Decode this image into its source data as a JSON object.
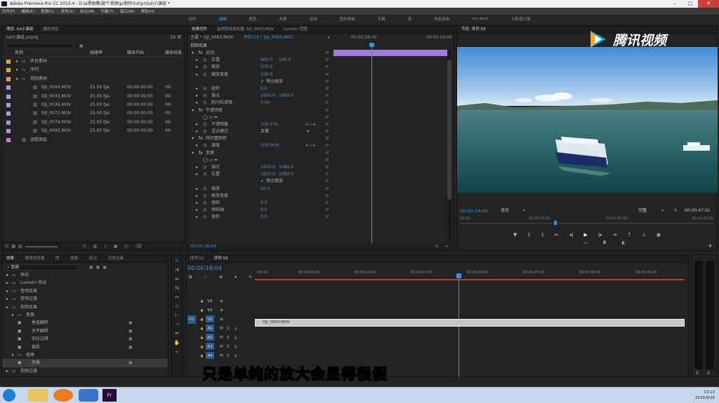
{
  "app": {
    "title": "Adobe Premiere Pro CC 2015.4 - D:\\a黑刚教\\配个视频\\pr制作\\lut\\pr\\lut\\小演组 *"
  },
  "menu": [
    "文件(F)",
    "编辑(E)",
    "剪辑(C)",
    "序列(S)",
    "标记(M)",
    "字幕(T)",
    "窗口(W)",
    "帮助(H)"
  ],
  "workspaces": [
    {
      "label": "组件",
      "active": false
    },
    {
      "label": "编辑",
      "active": true
    },
    {
      "label": "颜色",
      "active": false
    },
    {
      "label": "效果",
      "active": false
    },
    {
      "label": "音频",
      "active": false
    },
    {
      "label": "图形模板",
      "active": false
    },
    {
      "label": "字幕",
      "active": false
    },
    {
      "label": "库",
      "active": false
    },
    {
      "label": "所有面板",
      "active": false
    },
    {
      "label": "my work",
      "active": false
    },
    {
      "label": "元数据记录",
      "active": false
    }
  ],
  "project": {
    "tab": "项目: lut小演组",
    "sub_tab": "媒体浏览",
    "file": "lut小演组.prproj",
    "count": "10 项",
    "col_name": "名称",
    "col_rate": "帧速率",
    "col_start": "媒体开始",
    "col_end": "媒体结束",
    "items": [
      {
        "name": "声音素材",
        "rate": "",
        "start": "",
        "end": "",
        "color": "#e8a23a",
        "type": "folder",
        "indent": 0
      },
      {
        "name": "序列",
        "rate": "",
        "start": "",
        "end": "",
        "color": "#e8a23a",
        "type": "folder",
        "indent": 0
      },
      {
        "name": "视频素材",
        "rate": "",
        "start": "",
        "end": "",
        "color": "#e8a23a",
        "type": "folder",
        "indent": 0
      },
      {
        "name": "DJI_0004.MOV",
        "rate": "25.00 fps",
        "start": "00:00:00:00",
        "end": "00:",
        "color": "#a99bd8",
        "type": "clip",
        "indent": 1
      },
      {
        "name": "DJI_0033.MOV",
        "rate": "25.00 fps",
        "start": "00:00:00:00",
        "end": "00:",
        "color": "#a99bd8",
        "type": "clip",
        "indent": 1
      },
      {
        "name": "DJI_0036.MOV",
        "rate": "25.00 fps",
        "start": "00:00:00:00",
        "end": "00:",
        "color": "#a99bd8",
        "type": "clip",
        "indent": 1
      },
      {
        "name": "DJI_0072.MOV",
        "rate": "25.00 fps",
        "start": "00:00:00:00",
        "end": "00:",
        "color": "#a99bd8",
        "type": "clip",
        "indent": 1
      },
      {
        "name": "DJI_0074.MOV",
        "rate": "25.00 fps",
        "start": "00:00:00:00",
        "end": "00:",
        "color": "#a99bd8",
        "type": "clip",
        "indent": 1
      },
      {
        "name": "DJI_0093.MOV",
        "rate": "25.00 fps",
        "start": "00:00:00:00",
        "end": "00:",
        "color": "#a99bd8",
        "type": "clip",
        "indent": 1
      },
      {
        "name": "调整图层",
        "rate": "",
        "start": "",
        "end": "",
        "color": "#d17ad6",
        "type": "layer",
        "indent": 0
      }
    ]
  },
  "effect_controls": {
    "tab": "效果控件",
    "tab2": "音频剪辑混合器: DJI_0093.MOV",
    "tab3": "Lumetri 范围",
    "source": "主要 * DJI_0093.MOV",
    "seq": "序列 03 * DJI_0093.MOV",
    "section": "视频效果",
    "ruler_start": "00:00:18:00",
    "ruler_end": "00:00:19:00",
    "timecode": "00:00:18:04",
    "rows": [
      {
        "name": "运动",
        "v1": "",
        "v2": "",
        "level": 0,
        "fx": true
      },
      {
        "name": "位置",
        "v1": "960.0",
        "v2": "540.0",
        "level": 1
      },
      {
        "name": "缩放",
        "v1": "100.0",
        "v2": "",
        "level": 1
      },
      {
        "name": "缩放宽度",
        "v1": "100.0",
        "v2": "",
        "level": 1
      },
      {
        "name": "等比缩放",
        "v1": "",
        "v2": "",
        "level": 1,
        "check": true
      },
      {
        "name": "旋转",
        "v1": "0.0",
        "v2": "",
        "level": 1
      },
      {
        "name": "锚点",
        "v1": "1920.0",
        "v2": "1080.0",
        "level": 1
      },
      {
        "name": "防闪烁滤镜",
        "v1": "0.00",
        "v2": "",
        "level": 1
      },
      {
        "name": "不透明度",
        "v1": "",
        "v2": "",
        "level": 0,
        "fx": true
      },
      {
        "name": "",
        "v1": "",
        "v2": "",
        "level": 1,
        "shapes": true
      },
      {
        "name": "不透明度",
        "v1": "100.0 %",
        "v2": "",
        "level": 1
      },
      {
        "name": "混合模式",
        "v1": "正常",
        "v2": "",
        "level": 1
      },
      {
        "name": "时间重映射",
        "v1": "",
        "v2": "",
        "level": 0,
        "fx": true
      },
      {
        "name": "速度",
        "v1": "100.00%",
        "v2": "",
        "level": 1
      },
      {
        "name": "变换",
        "v1": "",
        "v2": "",
        "level": 0,
        "fx": true
      },
      {
        "name": "",
        "v1": "",
        "v2": "",
        "level": 1,
        "shapes": true
      },
      {
        "name": "锚点",
        "v1": "1920.0",
        "v2": "1080.0",
        "level": 1
      },
      {
        "name": "位置",
        "v1": "1920.0",
        "v2": "1080.0",
        "level": 1
      },
      {
        "name": "等比缩放",
        "v1": "",
        "v2": "",
        "level": 1,
        "check": true
      },
      {
        "name": "缩放",
        "v1": "50.0",
        "v2": "",
        "level": 1
      },
      {
        "name": "缩放宽度",
        "v1": "",
        "v2": "",
        "level": 1
      },
      {
        "name": "倾斜",
        "v1": "0.0",
        "v2": "",
        "level": 1
      },
      {
        "name": "倾斜轴",
        "v1": "0.0",
        "v2": "",
        "level": 1
      },
      {
        "name": "旋转",
        "v1": "0.0",
        "v2": "",
        "level": 1
      }
    ]
  },
  "program": {
    "tab": "节目: 序列 03",
    "timecode": "00:00:18:04",
    "fit": "适合",
    "quality": "完整",
    "duration": "00:00:47:01",
    "ruler": [
      "00:00",
      "00:00:15:00",
      "00:00:30:00",
      "00:00:45:00"
    ],
    "watermark": "腾讯视频"
  },
  "effects": {
    "tab": "效果",
    "tab2": "媒体浏览器",
    "tab3": "库",
    "tab4": "信息",
    "tab5": "标记",
    "tab6": "历史记录",
    "search": "变换",
    "items": [
      {
        "name": "预设",
        "level": 0,
        "type": "folder"
      },
      {
        "name": "Lumetri 预设",
        "level": 0,
        "type": "folder"
      },
      {
        "name": "音频效果",
        "level": 0,
        "type": "folder"
      },
      {
        "name": "音频过渡",
        "level": 0,
        "type": "folder"
      },
      {
        "name": "视频效果",
        "level": 0,
        "type": "folder"
      },
      {
        "name": "变换",
        "level": 1,
        "type": "folder"
      },
      {
        "name": "垂直翻转",
        "level": 2,
        "type": "fx"
      },
      {
        "name": "水平翻转",
        "level": 2,
        "type": "fx"
      },
      {
        "name": "羽化边缘",
        "level": 2,
        "type": "fx"
      },
      {
        "name": "裁剪",
        "level": 2,
        "type": "fx"
      },
      {
        "name": "扭曲",
        "level": 1,
        "type": "folder"
      },
      {
        "name": "变换",
        "level": 2,
        "type": "fx",
        "selected": true
      },
      {
        "name": "视频过渡",
        "level": 0,
        "type": "folder"
      }
    ]
  },
  "timeline": {
    "tab1": "序列 02",
    "tab2": "序列 03",
    "timecode": "00:00:18:04",
    "ruler": [
      ":00:00",
      "00:00:05:00",
      "00:00:10:00",
      "00:00:15:00",
      "00:00:20:00",
      "00:00:25:00",
      "00:00:30:00",
      "00:00:35:00"
    ],
    "tracks": [
      {
        "name": "V3"
      },
      {
        "name": "V2"
      },
      {
        "name": "V1"
      },
      {
        "name": "A1"
      },
      {
        "name": "A2"
      },
      {
        "name": "A3"
      },
      {
        "name": "A4"
      }
    ],
    "clip": "DJI_0093.MOV"
  },
  "meter": {
    "s1": "S",
    "s2": "S"
  },
  "subtitle": "只是单纯的放大会显得很假",
  "taskbar": {
    "time": "13:13",
    "date": "2018/8/26"
  }
}
